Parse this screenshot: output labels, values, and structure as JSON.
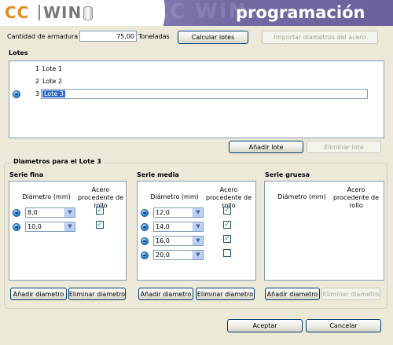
{
  "header": {
    "logo_cc": "CC",
    "logo_win": "WIN",
    "watermark": "CC WIN",
    "title": "programación"
  },
  "top_row": {
    "cantidad_label": "Cantidad de armadura",
    "cantidad_value": "75,00",
    "unit_label": "Toneladas",
    "calcular_button": "Calcular lotes",
    "importar_button": "Importar diametros del acero"
  },
  "lotes": {
    "section_label": "Lotes",
    "rows": [
      {
        "num": "1",
        "name": "Lote 1"
      },
      {
        "num": "2",
        "name": "Lote 2"
      },
      {
        "num": "3",
        "name": "Lote 3"
      }
    ],
    "add_button": "Añadir lote",
    "remove_button": "Eliminar lote"
  },
  "diametros": {
    "group_label": "Diametros para el Lote 3",
    "col_diametro": "Diámetro (mm)",
    "col_acero": "Acero procedente de rollo",
    "add_button": "Añadir diametro",
    "remove_button": "Eliminar diametro",
    "series": [
      {
        "title": "Serie fina",
        "rows": [
          {
            "value": "8,0",
            "checked": true
          },
          {
            "value": "10,0",
            "checked": true
          }
        ]
      },
      {
        "title": "Serie media",
        "rows": [
          {
            "value": "12,0",
            "checked": true
          },
          {
            "value": "14,0",
            "checked": true
          },
          {
            "value": "16,0",
            "checked": true
          },
          {
            "value": "20,0",
            "checked": false
          }
        ]
      },
      {
        "title": "Serie gruesa",
        "rows": []
      }
    ]
  },
  "footer": {
    "accept_button": "Aceptar",
    "cancel_button": "Cancelar"
  },
  "colors": {
    "banner_purple": "#746aa3",
    "logo_orange": "#e58a1e",
    "selection_blue": "#316ac5",
    "window_bg": "#ece9d8"
  }
}
